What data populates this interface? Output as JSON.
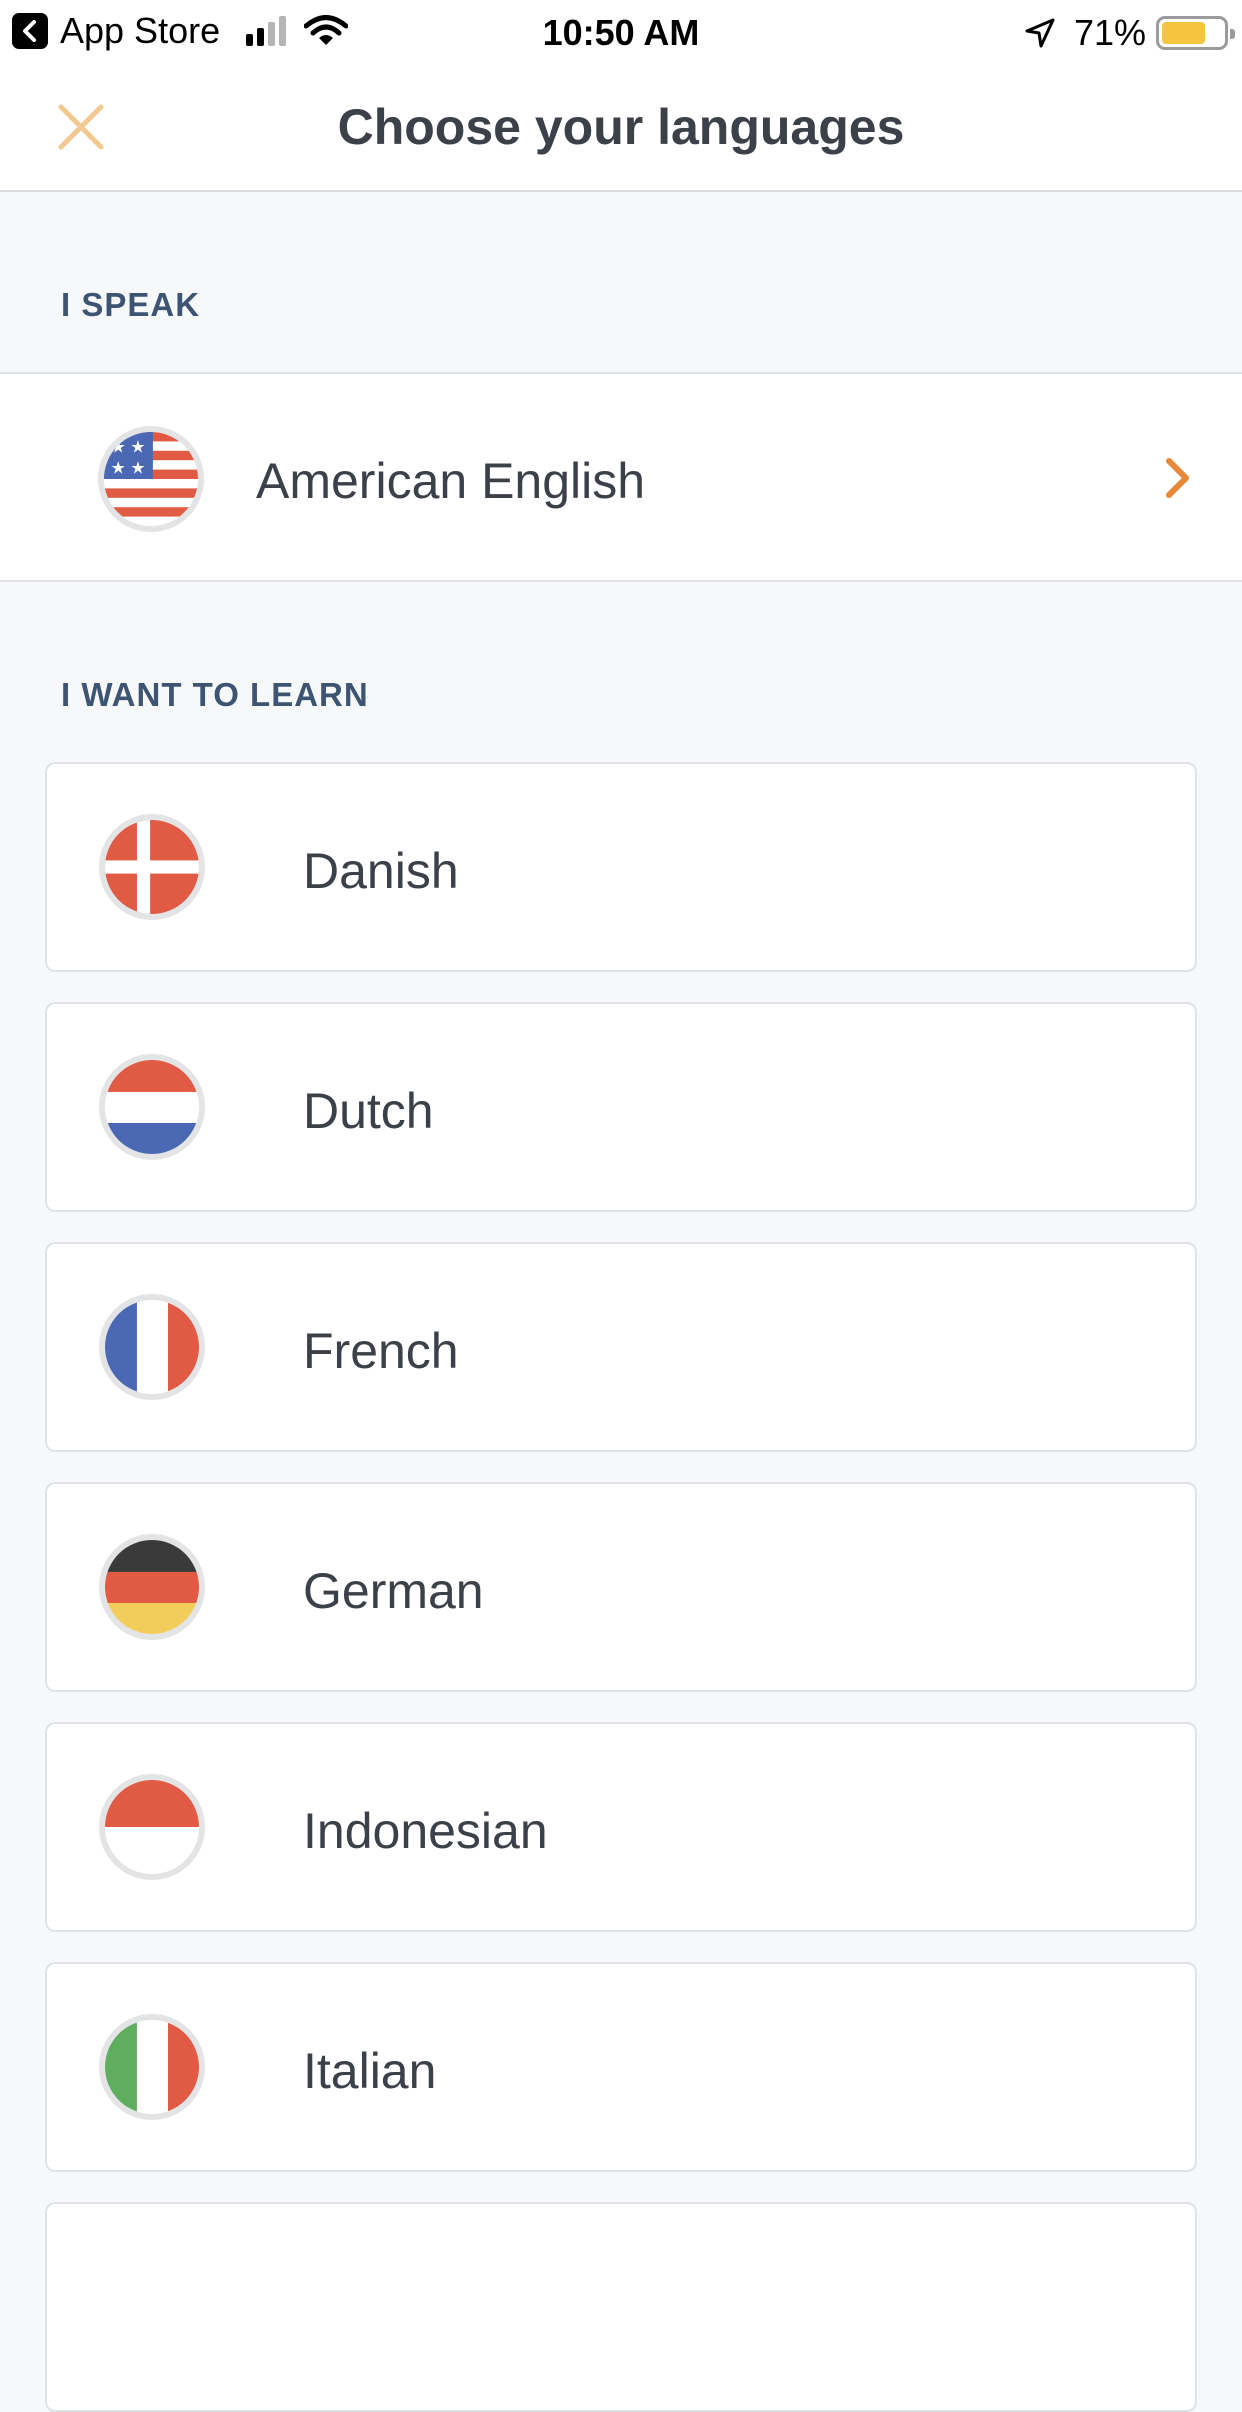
{
  "status_bar": {
    "back_app": "App Store",
    "time": "10:50 AM",
    "battery": "71%",
    "battery_level": 0.71
  },
  "header": {
    "title": "Choose your languages",
    "close_icon": "close-icon"
  },
  "speak_section": {
    "label": "I SPEAK",
    "selected": {
      "name": "American English",
      "flag": "us-flag-icon"
    }
  },
  "learn_section": {
    "label": "I WANT TO LEARN",
    "languages": [
      {
        "name": "Danish",
        "flag": "denmark-flag-icon"
      },
      {
        "name": "Dutch",
        "flag": "netherlands-flag-icon"
      },
      {
        "name": "French",
        "flag": "france-flag-icon"
      },
      {
        "name": "German",
        "flag": "germany-flag-icon"
      },
      {
        "name": "Indonesian",
        "flag": "indonesia-flag-icon"
      },
      {
        "name": "Italian",
        "flag": "italy-flag-icon"
      }
    ]
  },
  "colors": {
    "accent": "#e8893a",
    "close": "#f2c98f",
    "label": "#3d5573",
    "text": "#3c4049"
  }
}
